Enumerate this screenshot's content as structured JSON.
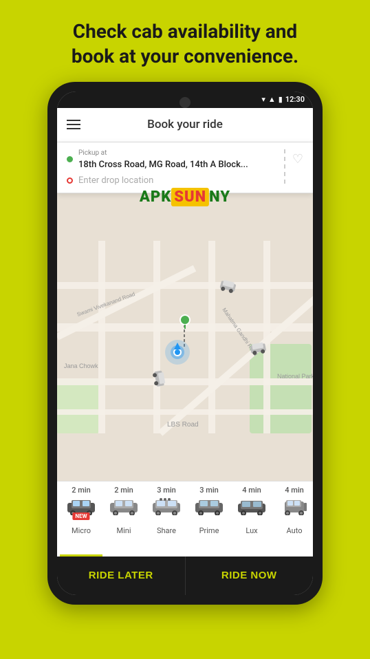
{
  "page": {
    "headline": "Check cab availability and\nbook at your convenience."
  },
  "status_bar": {
    "time": "12:30",
    "wifi": "▾",
    "signal": "▲",
    "battery": "▮"
  },
  "header": {
    "title": "Book your ride",
    "menu_label": "Menu"
  },
  "location": {
    "pickup_label": "Pickup at",
    "pickup_address": "18th Cross Road, MG Road, 14th A Block...",
    "drop_placeholder": "Enter drop location",
    "heart_icon": "♡"
  },
  "ride_options": [
    {
      "time": "2 min",
      "name": "Micro",
      "is_new": true,
      "selected": true
    },
    {
      "time": "2 min",
      "name": "Mini",
      "is_new": false,
      "selected": false
    },
    {
      "time": "3 min",
      "name": "Share",
      "is_new": false,
      "selected": false
    },
    {
      "time": "3 min",
      "name": "Prime",
      "is_new": false,
      "selected": false
    },
    {
      "time": "4 min",
      "name": "Lux",
      "is_new": false,
      "selected": false
    },
    {
      "time": "4 min",
      "name": "Auto",
      "is_new": false,
      "selected": false
    }
  ],
  "buttons": {
    "ride_later": "RIDE LATER",
    "ride_now": "RIDE NOW"
  },
  "watermark": {
    "apk": "APK",
    "sun": "SUN",
    "ny": "NY"
  },
  "new_badge_label": "NEW"
}
